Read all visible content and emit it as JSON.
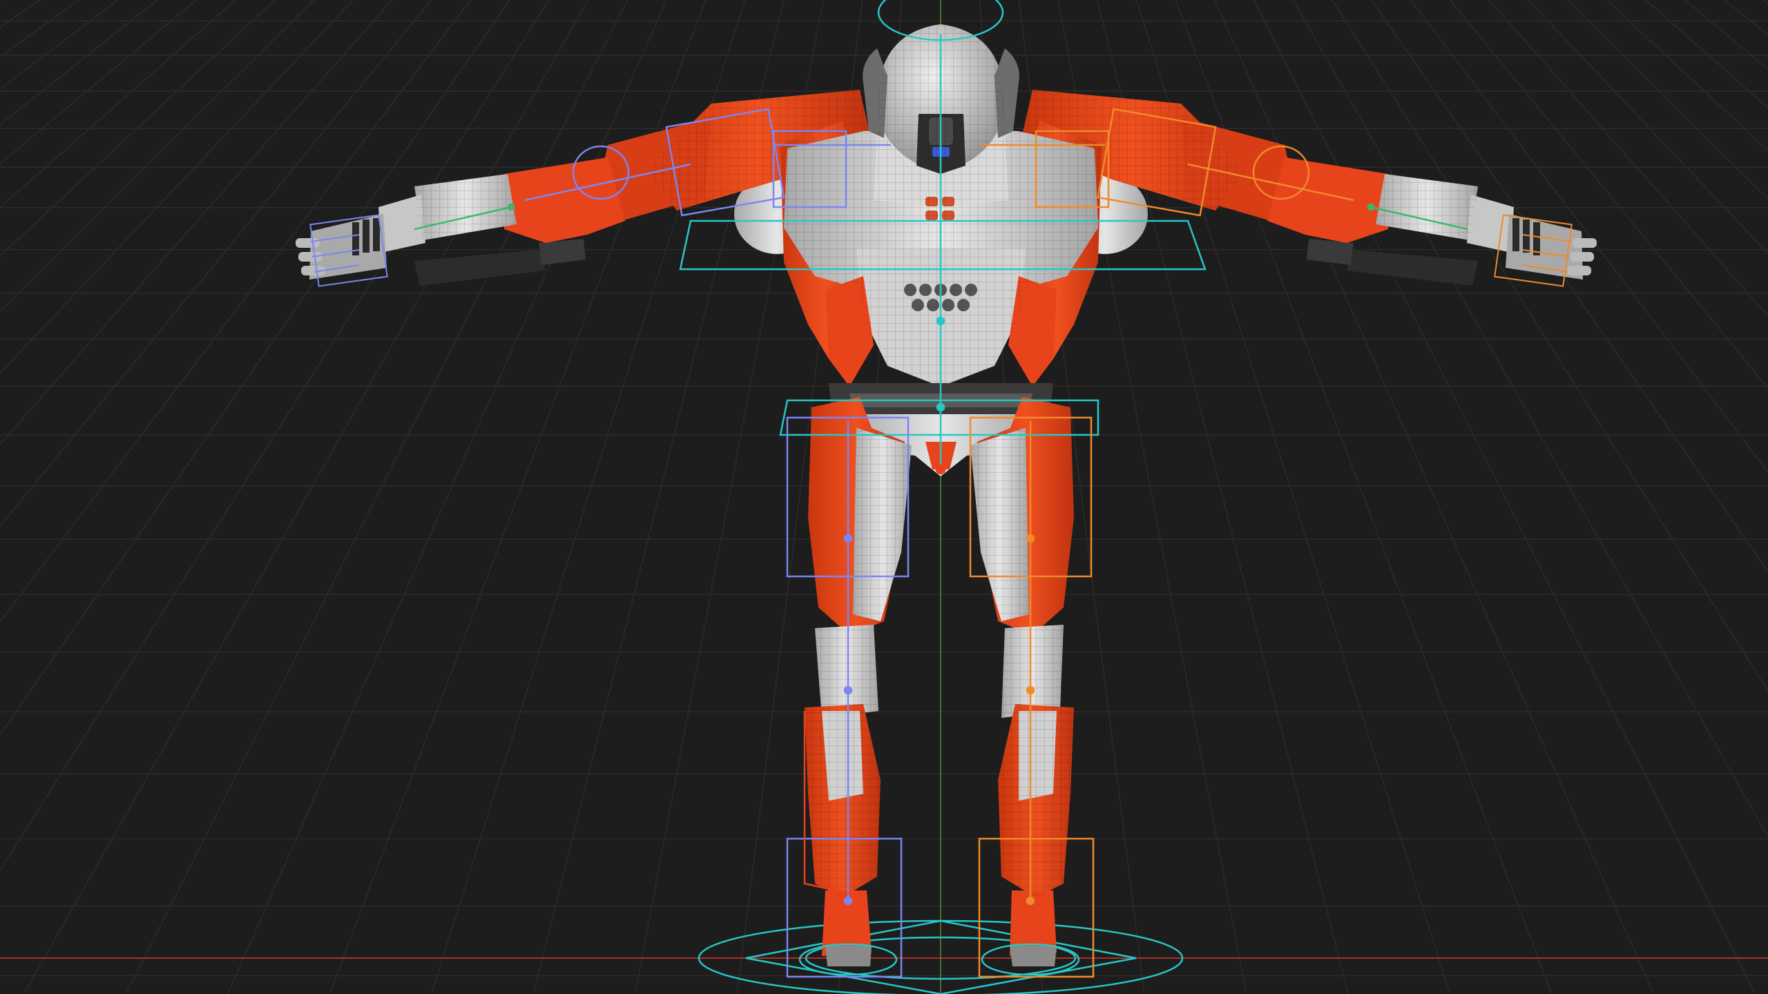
{
  "viewport": {
    "mode": "3d-rig-viewport",
    "background": "#1d1d1d",
    "grid_color": "#2c2c2c",
    "x_axis_color": "#a8322a",
    "y_axis_color": "#5a8a2e"
  },
  "model": {
    "pose": "t-pose",
    "colors": {
      "armor_orange": "#e8441c",
      "armor_orange_dark": "#b4300f",
      "plate_white": "#d9d9d9",
      "plate_shade": "#9a9a9a",
      "joint_dark": "#3a3a3a",
      "wire": "#4a4a4a"
    }
  },
  "rig": {
    "center_color": "#27c7c7",
    "left_color": "#7d86f0",
    "right_color": "#f08a2a",
    "hand_color": "#3bb86a",
    "bones": [
      "spine",
      "neck",
      "head",
      "pelvis",
      "upper-arm-left",
      "forearm-left",
      "hand-left",
      "upper-arm-right",
      "forearm-right",
      "hand-right",
      "thigh-left",
      "shin-left",
      "foot-left",
      "thigh-right",
      "shin-right",
      "foot-right"
    ]
  }
}
